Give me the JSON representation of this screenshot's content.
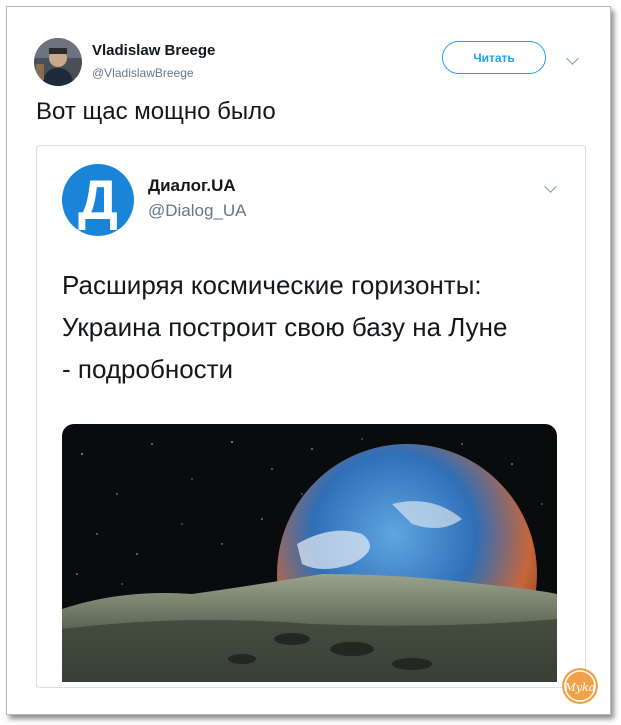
{
  "tweet": {
    "author": {
      "name": "Vladislaw Breege",
      "handle": "@VladislawBreege",
      "avatar_icon": "profile-photo"
    },
    "follow_label": "Читать",
    "menu_icon": "chevron-down-icon",
    "text": "Вот щас мощно было"
  },
  "quoted": {
    "author": {
      "name": "Диалог.UA",
      "handle": "@Dialog_UA",
      "logo_letter": "Д"
    },
    "text_lines": [
      "Расширяя космические горизонты:",
      "Украина построит свою базу на Луне",
      "- подробности"
    ],
    "image_icon": "earth-over-moon-photo"
  },
  "watermark": {
    "text": "Myka"
  },
  "colors": {
    "accent": "#1da1f2",
    "logo_blue": "#1a84d8",
    "text": "#14171a",
    "muted": "#657786",
    "watermark_orange": "#f0a24a"
  }
}
